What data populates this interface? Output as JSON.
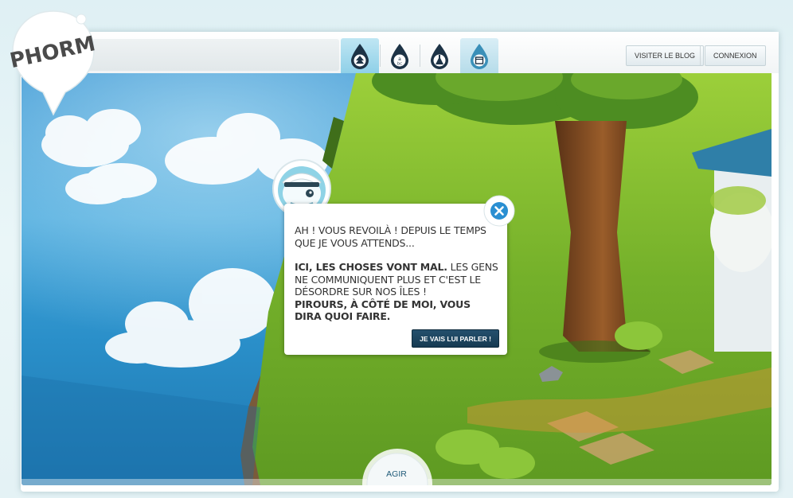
{
  "app": {
    "logo_text": "PHORM"
  },
  "nav": {
    "tabs": [
      {
        "icon": "tree-icon",
        "state": "active"
      },
      {
        "icon": "text-icon",
        "state": "normal"
      },
      {
        "icon": "bottle-icon",
        "state": "normal"
      },
      {
        "icon": "window-icon",
        "state": "highlight"
      }
    ]
  },
  "header": {
    "blog_label": "Visiter le blog",
    "login_label": "Connexion"
  },
  "dialog": {
    "line1": "Ah ! Vous revoilà ! Depuis le temps que je vous attends...",
    "bold1": "Ici, les choses vont mal.",
    "line2": " Les gens ne communiquent plus et c'est le désordre sur nos îles !",
    "bold2": "Pirours, à côté de moi, vous dira quoi faire.",
    "button_label": "Je vais lui parler !",
    "close_icon": "close-icon"
  },
  "action": {
    "label": "Agir"
  },
  "colors": {
    "accent": "#1a6fa0",
    "sky": "#2f8fd0",
    "grass": "#7cb82e",
    "dialog_button": "#1d4863"
  }
}
